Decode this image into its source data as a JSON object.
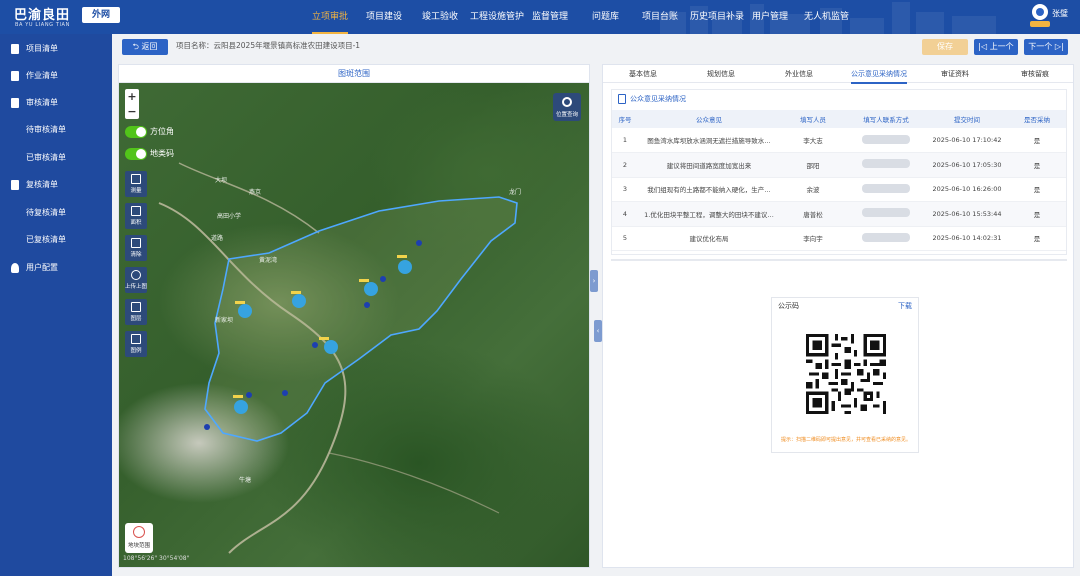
{
  "header": {
    "brand": "巴渝良田",
    "brand_en": "BA YU LIANG TIAN",
    "brand_tag": "外网",
    "nav": [
      "立项审批",
      "项目建设",
      "竣工验收",
      "工程设施管护",
      "监督管理",
      "问题库",
      "项目台账",
      "历史项目补录",
      "用户管理",
      "无人机监管"
    ],
    "active_nav": "立项审批",
    "user_name": "张璧"
  },
  "sidebar": {
    "items": [
      {
        "label": "项目清单",
        "type": "group",
        "icon": "document-icon"
      },
      {
        "label": "作业清单",
        "type": "group",
        "icon": "document-icon"
      },
      {
        "label": "审核清单",
        "type": "group",
        "icon": "document-icon"
      },
      {
        "label": "待审核清单",
        "type": "sub"
      },
      {
        "label": "已审核清单",
        "type": "sub"
      },
      {
        "label": "复核清单",
        "type": "group",
        "icon": "document-icon"
      },
      {
        "label": "待复核清单",
        "type": "sub"
      },
      {
        "label": "已复核清单",
        "type": "sub"
      },
      {
        "label": "用户配置",
        "type": "group",
        "icon": "user-icon"
      }
    ]
  },
  "toolbar": {
    "back_label": "返回",
    "project_label": "项目名称：云阳县2025年堰景镇高标准农田建设项目-1",
    "save_label": "保存",
    "prev_label": "上一个",
    "next_label": "下一个"
  },
  "map": {
    "title": "图斑范围",
    "zoom_in": "+",
    "zoom_out": "−",
    "toggles": [
      "方位角",
      "地类码"
    ],
    "tools": [
      "测量",
      "面积",
      "清除",
      "上传上图",
      "图层",
      "图例"
    ],
    "locate_label": "位置查询",
    "bottom_tool_label": "地块范围",
    "labels": [
      "大坝",
      "燕京",
      "道路",
      "高田小学",
      "黄泥湾",
      "龙门",
      "新家坝",
      "牛塘"
    ],
    "coord_text": "108°56'26\" 30°54'08\""
  },
  "right": {
    "tabs": [
      "基本信息",
      "规划信息",
      "外业信息",
      "公示意见采纳情况",
      "审证资料",
      "审核留痕"
    ],
    "active_tab": "公示意见采纳情况",
    "section_title": "公众意见采纳情况",
    "columns": [
      "序号",
      "公众意见",
      "填写人员",
      "填写人联系方式",
      "提交时间",
      "是否采纳"
    ],
    "rows": [
      {
        "no": "1",
        "opinion": "图鱼湾水库坝放水涵洞无遮拦措施导致水…",
        "person": "李大志",
        "contact": "",
        "time": "2025-06-10 17:10:42",
        "adopted": "是"
      },
      {
        "no": "2",
        "opinion": "建议将田间道路宽度加宽出来",
        "person": "邵阳",
        "contact": "",
        "time": "2025-06-10 17:05:30",
        "adopted": "是"
      },
      {
        "no": "3",
        "opinion": "我们组现有的土路都不能纳入硬化，生产…",
        "person": "余波",
        "contact": "",
        "time": "2025-06-10 16:26:00",
        "adopted": "是"
      },
      {
        "no": "4",
        "opinion": "1.优化田块平整工程，调整大的田块不建议…",
        "person": "唐普松",
        "contact": "",
        "time": "2025-06-10 15:53:44",
        "adopted": "是"
      },
      {
        "no": "5",
        "opinion": "建议优化布局",
        "person": "李向宇",
        "contact": "",
        "time": "2025-06-10 14:02:31",
        "adopted": "是"
      }
    ],
    "qr": {
      "title": "公示码",
      "download": "下载",
      "tip": "提示：扫描二维码即可提出意见，并可查看已采纳的意见。"
    }
  }
}
